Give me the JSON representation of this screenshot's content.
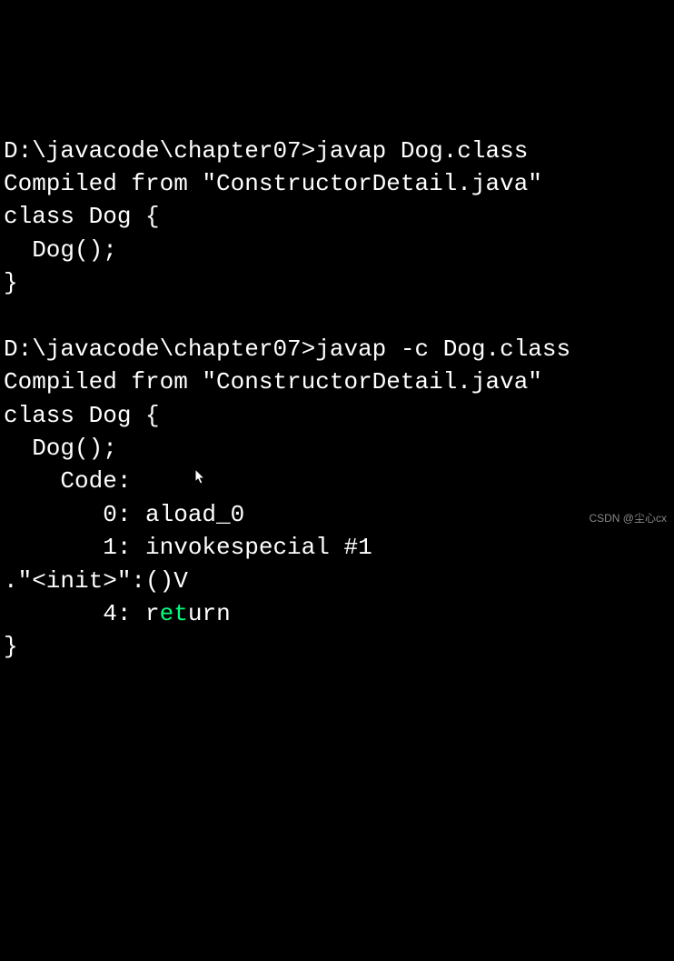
{
  "terminal": {
    "line1_prompt": "D:\\javacode\\chapter07>",
    "line1_cmd": "javap Dog.class",
    "line2": "Compiled from \"ConstructorDetail.java\"",
    "line3": "class Dog {",
    "line4": "  Dog();",
    "line5": "}",
    "blank": "",
    "line6_prompt": "D:\\javacode\\chapter07>",
    "line6_cmd": "javap -c Dog.class",
    "line7": "Compiled from \"ConstructorDetail.java\"",
    "line8": "class Dog {",
    "line9": "  Dog();",
    "line10": "    Code:",
    "line11": "       0: aload_0",
    "line12": "       1: invokespecial #1",
    "line13": ".\"<init>\":()V",
    "line14_a": "       4: r",
    "line14_b": "et",
    "line14_c": "urn",
    "line15": "}"
  },
  "watermark": "CSDN @尘心cx"
}
